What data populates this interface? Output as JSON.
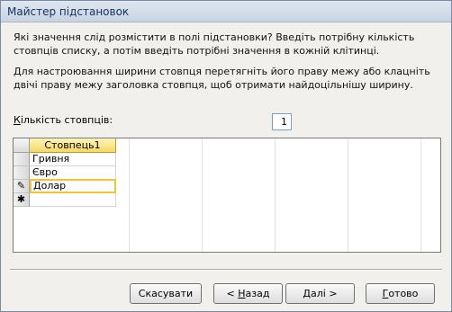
{
  "window": {
    "title": "Майстер підстановок"
  },
  "instructions": {
    "line1": "Які значення слід розмістити в полі підстановки? Введіть потрібну кількість стовпців списку, а потім введіть потрібні значення в кожній клітинці.",
    "line2": "Для настроювання ширини стовпця перетягніть його праву межу або клацніть двічі праву межу заголовка стовпця, щоб отримати найдоцільнішу ширину."
  },
  "columns_count": {
    "label_prefix": "К",
    "label_rest": "ількість стовпців:",
    "value": "1"
  },
  "grid": {
    "column_header": "Стовпець1",
    "rows": [
      {
        "value": "Гривня",
        "selector": ""
      },
      {
        "value": "Євро",
        "selector": ""
      },
      {
        "value": "Долар",
        "selector": "✎"
      },
      {
        "value": "",
        "selector": "✱"
      }
    ]
  },
  "buttons": {
    "cancel": "Скасувати",
    "back_prefix": "< ",
    "back_key": "Н",
    "back_rest": "азад",
    "next_key": "Д",
    "next_rest": "алі >",
    "finish_key": "Г",
    "finish_rest": "отово"
  },
  "colors": {
    "header_accent": "#f8d86a",
    "active_cell_border": "#f4c13a"
  }
}
